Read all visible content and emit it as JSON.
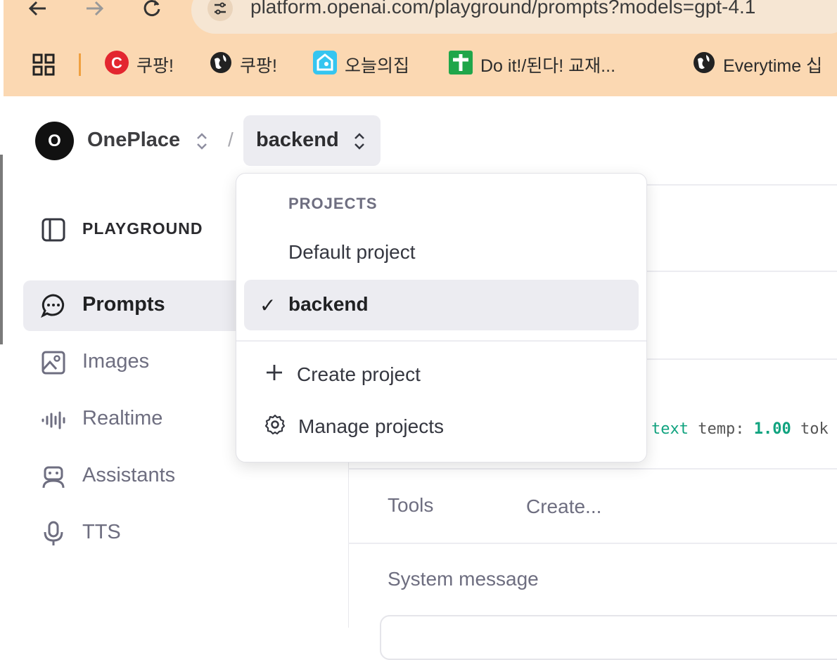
{
  "browser": {
    "url": "platform.openai.com/playground/prompts?models=gpt-4.1",
    "bookmarks": [
      {
        "label": "쿠팡!",
        "icon": "coupang-icon"
      },
      {
        "label": "쿠팡!",
        "icon": "globe-icon"
      },
      {
        "label": "오늘의집",
        "icon": "ohouse-icon"
      },
      {
        "label": "Do it!/된다! 교재...",
        "icon": "green-cross-icon"
      },
      {
        "label": "Everytime 십",
        "icon": "globe-icon"
      }
    ]
  },
  "header": {
    "org_initial": "O",
    "org_name": "OnePlace",
    "separator": "/",
    "project_name": "backend"
  },
  "sidebar": {
    "title": "PLAYGROUND",
    "items": [
      {
        "label": "Prompts",
        "icon": "chat-bubble-icon",
        "active": true
      },
      {
        "label": "Images",
        "icon": "image-icon",
        "active": false
      },
      {
        "label": "Realtime",
        "icon": "waveform-icon",
        "active": false
      },
      {
        "label": "Assistants",
        "icon": "robot-icon",
        "active": false
      },
      {
        "label": "TTS",
        "icon": "microphone-icon",
        "active": false
      }
    ]
  },
  "dropdown": {
    "section_title": "PROJECTS",
    "projects": [
      {
        "label": "Default project",
        "selected": false
      },
      {
        "label": "backend",
        "selected": true
      }
    ],
    "check_glyph": "✓",
    "actions": [
      {
        "label": "Create project",
        "icon": "plus-icon"
      },
      {
        "label": "Manage projects",
        "icon": "gear-icon"
      }
    ]
  },
  "main": {
    "model_meta": {
      "text_word": "text",
      "temp_label": "temp:",
      "temp_value": "1.00",
      "tok_label": "tok"
    },
    "tools_label": "Tools",
    "tools_create": "Create...",
    "system_message_label": "System message"
  }
}
